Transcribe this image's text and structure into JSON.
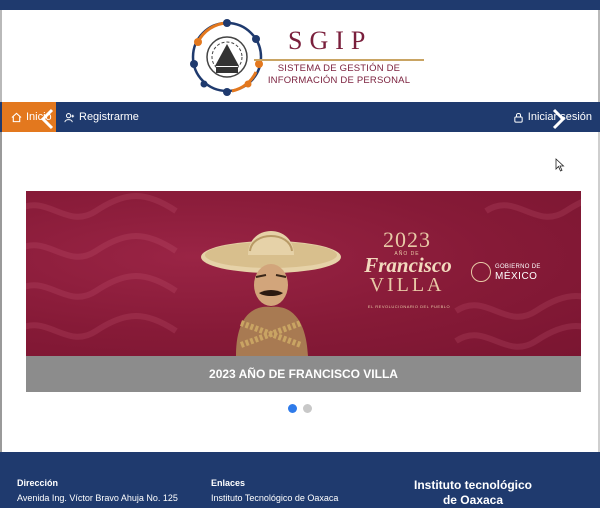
{
  "brand": {
    "acronym": "SGIP",
    "subtitle_line1": "SISTEMA DE GESTIÓN DE",
    "subtitle_line2": "INFORMACIÓN DE PERSONAL",
    "logo_text": "ITO"
  },
  "nav": {
    "home": "Inicio",
    "register": "Registrarme",
    "login": "Iniciar sesión"
  },
  "carousel": {
    "year": "2023",
    "anio_de": "AÑO DE",
    "francisco": "Francisco",
    "villa": "VILLA",
    "tagline": "EL REVOLUCIONARIO DEL PUEBLO",
    "gob_small": "GOBIERNO DE",
    "gob_big": "MÉXICO",
    "caption": "2023 AÑO DE FRANCISCO VILLA",
    "active_slide": 1,
    "slide_count": 2
  },
  "footer": {
    "direccion_title": "Dirección",
    "direccion_text": "Avenida Ing. Víctor Bravo Ahuja No. 125",
    "enlaces_title": "Enlaces",
    "enlaces_text": "Instituto Tecnológico de Oaxaca",
    "institute_line1": "Instituto tecnológico",
    "institute_line2": "de Oaxaca"
  },
  "colors": {
    "navy": "#1f3a6e",
    "orange": "#e3781e",
    "maroon": "#8a1c3b",
    "gold": "#c9a463"
  }
}
